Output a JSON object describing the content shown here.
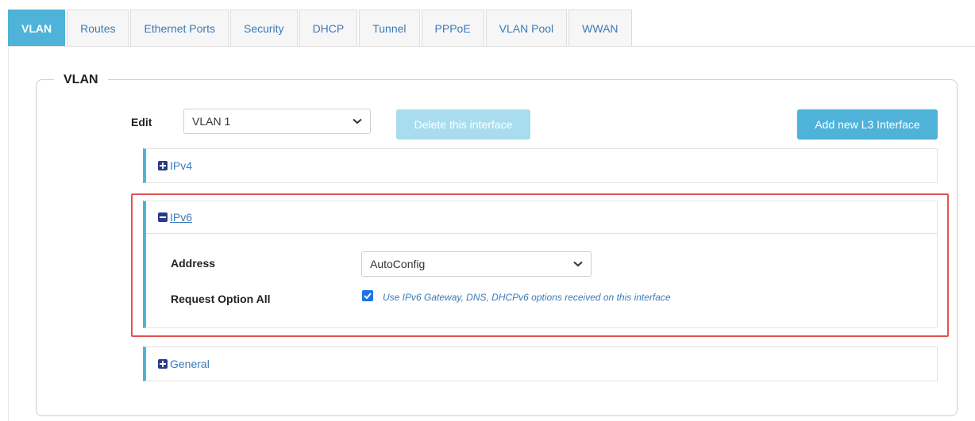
{
  "tabs": [
    {
      "label": "VLAN",
      "active": true
    },
    {
      "label": "Routes"
    },
    {
      "label": "Ethernet Ports"
    },
    {
      "label": "Security"
    },
    {
      "label": "DHCP"
    },
    {
      "label": "Tunnel"
    },
    {
      "label": "PPPoE"
    },
    {
      "label": "VLAN Pool"
    },
    {
      "label": "WWAN"
    }
  ],
  "section": {
    "legend": "VLAN",
    "edit_label": "Edit",
    "edit_value": "VLAN 1",
    "delete_button": "Delete this interface",
    "add_button": "Add new L3 Interface"
  },
  "panels": {
    "ipv4": {
      "title": "IPv4",
      "expanded": false
    },
    "ipv6": {
      "title": "IPv6",
      "expanded": true,
      "address_label": "Address",
      "address_value": "AutoConfig",
      "request_label": "Request Option All",
      "request_checked": true,
      "request_text": "Use IPv6 Gateway, DNS, DHCPv6 options received on this interface"
    },
    "general": {
      "title": "General",
      "expanded": false
    }
  },
  "colors": {
    "accent": "#4fb3d9",
    "highlight_border": "#e05252",
    "link": "#3a7ab9"
  }
}
